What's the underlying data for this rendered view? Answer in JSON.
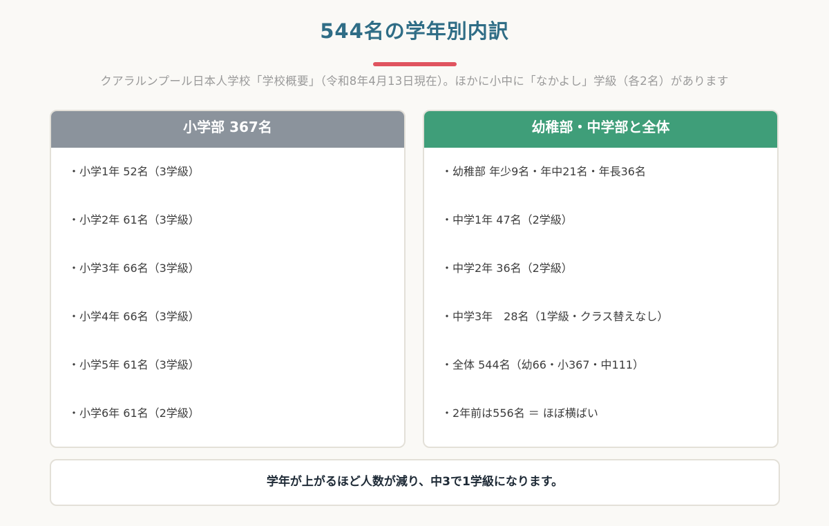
{
  "header": {
    "title": "544名の学年別内訳",
    "subtitle": "クアラルンプール日本人学校「学校概要」（令和8年4月13日現在）。ほかに小中に「なかよし」学級（各2名）があります",
    "accent_color": "#e0545f",
    "title_color": "#2f6d86"
  },
  "left_card": {
    "title": "小学部 367名",
    "header_color": "#8b939c",
    "items": [
      "・小学1年 52名（3学級）",
      "・小学2年 61名（3学級）",
      "・小学3年 66名（3学級）",
      "・小学4年 66名（3学級）",
      "・小学5年 61名（3学級）",
      "・小学6年 61名（2学級）"
    ]
  },
  "right_card": {
    "title": "幼稚部・中学部と全体",
    "header_color": "#3f9e79",
    "items": [
      "・幼稚部 年少9名・年中21名・年長36名",
      "・中学1年 47名（2学級）",
      "・中学2年 36名（2学級）",
      "・中学3年　28名（1学級・クラス替えなし）",
      "・全体 544名（幼66・小367・中111）",
      "・2年前は556名 ＝ ほぼ横ばい"
    ]
  },
  "footer": {
    "note": "学年が上がるほど人数が減り、中3で1学級になります。"
  }
}
